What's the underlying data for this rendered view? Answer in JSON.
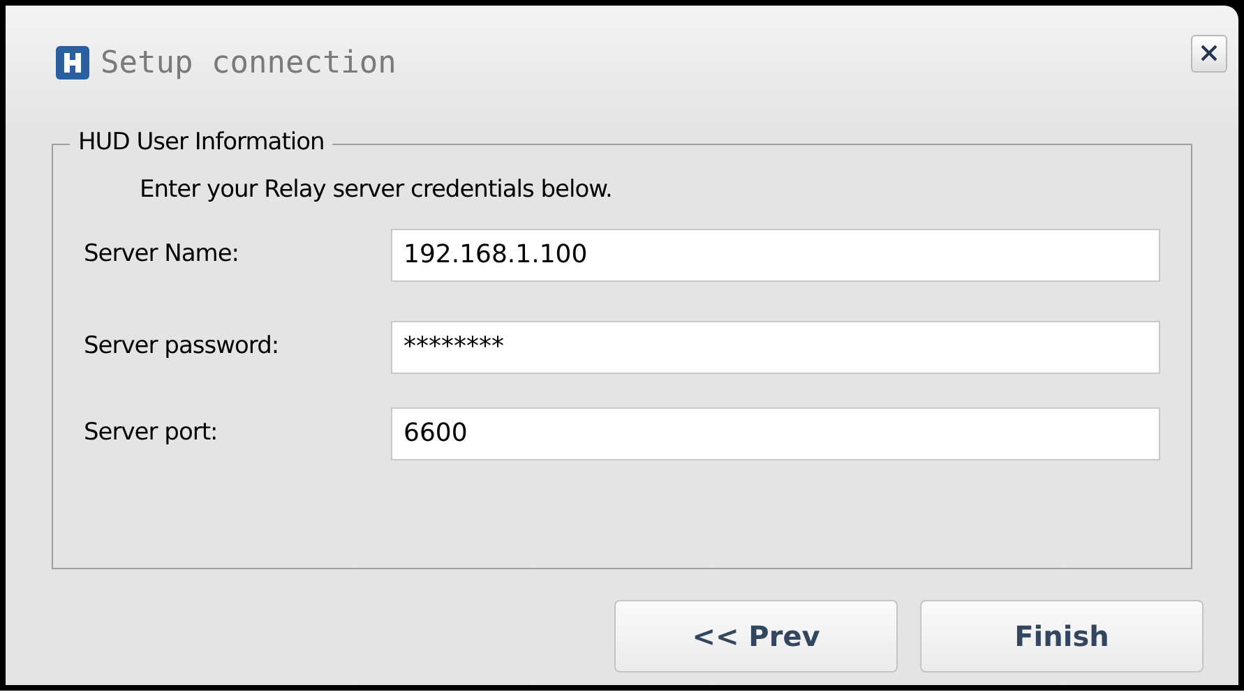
{
  "window": {
    "title": "Setup connection"
  },
  "group": {
    "legend": "HUD User Information",
    "description": "Enter your Relay server credentials below."
  },
  "fields": [
    {
      "label": "Server Name:",
      "value": "192.168.1.100"
    },
    {
      "label": "Server password:",
      "value": "********"
    },
    {
      "label": "Server port:",
      "value": "6600"
    }
  ],
  "buttons": [
    "<< Prev",
    "Finish"
  ]
}
